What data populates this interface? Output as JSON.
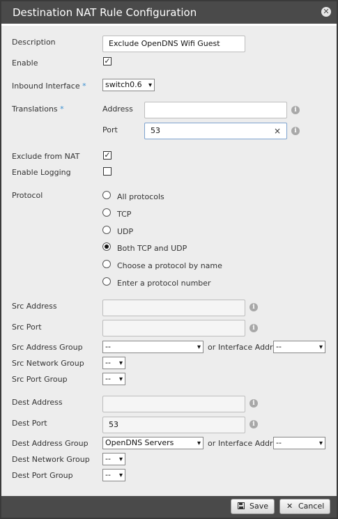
{
  "dialog": {
    "title": "Destination NAT Rule Configuration",
    "close_icon": "x"
  },
  "fields": {
    "description_label": "Description",
    "description_value": "Exclude OpenDNS Wifi Guest",
    "enable_label": "Enable",
    "enable_checked": true,
    "inbound_interface_label": "Inbound Interface",
    "inbound_interface_value": "switch0.6",
    "translations_label": "Translations",
    "address_label": "Address",
    "address_value": "",
    "port_label": "Port",
    "port_value": "53",
    "exclude_label": "Exclude from NAT",
    "exclude_checked": true,
    "logging_label": "Enable Logging",
    "logging_checked": false,
    "protocol_label": "Protocol",
    "protocols": [
      {
        "label": "All protocols",
        "selected": false
      },
      {
        "label": "TCP",
        "selected": false
      },
      {
        "label": "UDP",
        "selected": false
      },
      {
        "label": "Both TCP and UDP",
        "selected": true
      },
      {
        "label": "Choose a protocol by name",
        "selected": false
      },
      {
        "label": "Enter a protocol number",
        "selected": false
      }
    ],
    "src_address_label": "Src Address",
    "src_port_label": "Src Port",
    "src_address_group_label": "Src Address Group",
    "src_address_group_value": "--",
    "or_text": "or",
    "interface_addr_label": "Interface Addr",
    "src_interface_addr_value": "--",
    "src_network_group_label": "Src Network Group",
    "src_network_group_value": "--",
    "src_port_group_label": "Src Port Group",
    "src_port_group_value": "--",
    "dest_address_label": "Dest Address",
    "dest_port_label": "Dest Port",
    "dest_port_value": "53",
    "dest_address_group_label": "Dest Address Group",
    "dest_address_group_value": "OpenDNS Servers",
    "dest_interface_addr_value": "--",
    "dest_network_group_label": "Dest Network Group",
    "dest_network_group_value": "--",
    "dest_port_group_label": "Dest Port Group",
    "dest_port_group_value": "--"
  },
  "footer": {
    "save_label": "Save",
    "cancel_label": "Cancel"
  },
  "icons": {
    "info": "i",
    "checkmark": "✓",
    "clear": "×",
    "dropdown": "⌄"
  }
}
